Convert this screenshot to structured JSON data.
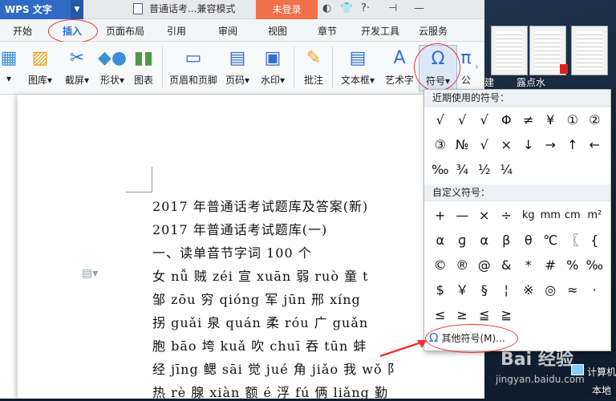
{
  "desktop": {
    "labels": [
      "露点水",
      "计算机",
      "本地"
    ],
    "partial_labels": [
      "建",
      "Io"
    ]
  },
  "titlebar": {
    "app_name": "WPS 文字",
    "doc_tab": "普通话考...兼容模式",
    "login": "未登录"
  },
  "tabs": [
    "开始",
    "插入",
    "页面布局",
    "引用",
    "审阅",
    "视图",
    "章节",
    "开发工具",
    "云服务"
  ],
  "ribbon": {
    "buttons": [
      "图库",
      "截屏",
      "形状",
      "图表",
      "页眉和页脚",
      "页码",
      "水印",
      "批注",
      "文本框",
      "艺术字",
      "符号",
      "公"
    ]
  },
  "document": {
    "lines": [
      "2017 年普通话考试题库及答案(新)",
      "2017 年普通话考试题库(一)",
      "一、读单音节字词 100 个",
      "女 nǚ 贼 zéi 宣 xuān 弱 ruò 童 t",
      "邹 zōu 穷 qióng 军 jūn 邢 xíng",
      "拐 guǎi 泉 quán 柔 róu 广 guǎn",
      "胞 bāo 垮 kuǎ 吹 chuī 吞 tūn 蚌",
      "经 jīng 鳃 sāi 觉 jué 角 jiǎo 我 wǒ 阝",
      "热 rè 腺 xiàn 额 é 浮 fú 俩 liǎng 勤"
    ]
  },
  "symbol_popup": {
    "recent_title": "近期使用的符号：",
    "recent_symbols": [
      "√",
      "√",
      "√",
      "Φ",
      "≠",
      "¥",
      "①",
      "②",
      "③",
      "№",
      "√",
      "×",
      "↓",
      "→",
      "↑",
      "←",
      "‰",
      "¾",
      "½",
      "¼"
    ],
    "custom_title": "自定义符号：",
    "custom_symbols": [
      "+",
      "—",
      "×",
      "÷",
      "kg",
      "mm",
      "cm",
      "m²",
      "α",
      "ɡ",
      "α",
      "β",
      "θ",
      "℃",
      "〖",
      "{",
      "©",
      "®",
      "@",
      "&",
      "*",
      "#",
      "%",
      "‰",
      "$",
      "￥",
      "§",
      "¦",
      "※",
      "◎",
      "≈",
      "·",
      "≤",
      "≥",
      "≦",
      "≧"
    ],
    "more_label": "其他符号(M)..."
  },
  "watermark": {
    "text": "Bai 经验",
    "url": "jingyan.baidu.com"
  },
  "colors": {
    "accent": "#2e6fd0",
    "login": "#f0704a",
    "highlight_circle": "#e33333"
  }
}
